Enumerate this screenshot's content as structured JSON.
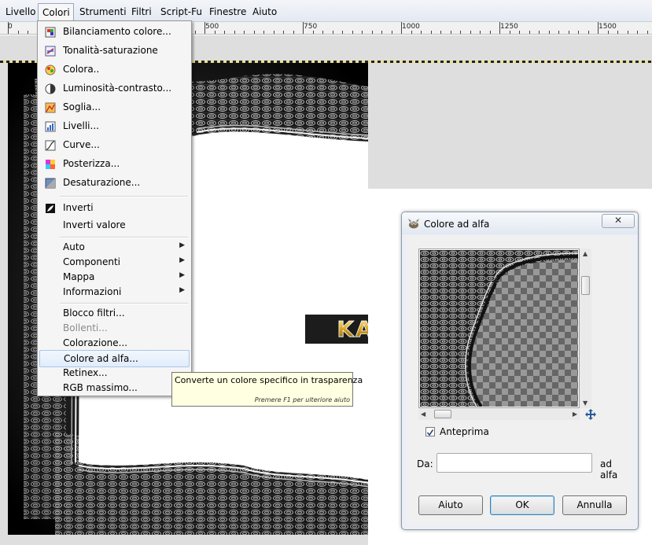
{
  "menubar": {
    "items": [
      "Livello",
      "Colori",
      "Strumenti",
      "Filtri",
      "Script-Fu",
      "Finestre",
      "Aiuto"
    ]
  },
  "ruler": {
    "labels": [
      "0",
      "500",
      "750",
      "1000",
      "1250",
      "1500"
    ]
  },
  "menu": {
    "items": [
      {
        "label": "Bilanciamento colore...",
        "icon": "color-balance-icon"
      },
      {
        "label": "Tonalità-saturazione",
        "icon": "hue-saturation-icon"
      },
      {
        "label": "Colora..",
        "icon": "colorize-icon"
      },
      {
        "label": "Luminosità-contrasto...",
        "icon": "brightness-contrast-icon"
      },
      {
        "label": "Soglia...",
        "icon": "threshold-icon"
      },
      {
        "label": "Livelli...",
        "icon": "levels-icon"
      },
      {
        "label": "Curve...",
        "icon": "curves-icon"
      },
      {
        "label": "Posterizza...",
        "icon": "posterize-icon"
      },
      {
        "label": "Desaturazione...",
        "icon": "desaturate-icon"
      },
      {
        "label": "Inverti",
        "icon": "invert-icon"
      },
      {
        "label": "Inverti valore"
      },
      {
        "label": "Auto",
        "submenu": true
      },
      {
        "label": "Componenti",
        "submenu": true
      },
      {
        "label": "Mappa",
        "submenu": true
      },
      {
        "label": "Informazioni",
        "submenu": true
      },
      {
        "label": "Blocco filtri..."
      },
      {
        "label": "Bollenti...",
        "disabled": true
      },
      {
        "label": "Colorazione..."
      },
      {
        "label": "Colore ad alfa...",
        "highlighted": true
      },
      {
        "label": "Retinex..."
      },
      {
        "label": "RGB massimo..."
      }
    ]
  },
  "tooltip": {
    "text": "Converte un colore specifico in trasparenza",
    "hint": "Premere F1 per ulteriore aiuto"
  },
  "watermark": {
    "text": "KAINTS.COM"
  },
  "dialog": {
    "title": "Colore ad alfa",
    "close": "✕",
    "preview_label": "Anteprima",
    "preview_checked": true,
    "from_label": "Da:",
    "from_value": "",
    "to_label": "ad alfa",
    "buttons": {
      "help": "Aiuto",
      "ok": "OK",
      "cancel": "Annulla"
    }
  },
  "colors": {
    "menu_highlight": "#e1ecfb",
    "tooltip_bg": "#ffffe1",
    "selection_marching_ants": "#e9e18a",
    "watermark_gold": "#d9a520"
  }
}
